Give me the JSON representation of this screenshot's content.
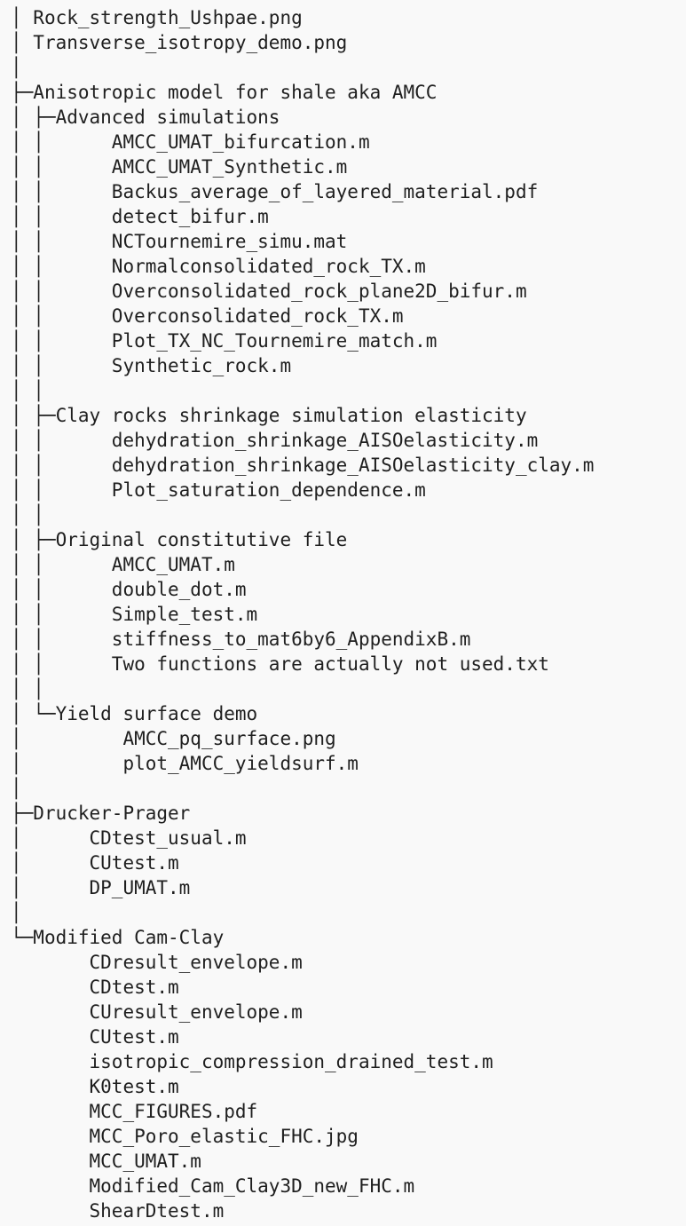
{
  "tree": {
    "lines": [
      {
        "prefix": "│ ",
        "text": "Rock_strength_Ushpae.png"
      },
      {
        "prefix": "│ ",
        "text": "Transverse_isotropy_demo.png"
      },
      {
        "prefix": "│",
        "text": ""
      },
      {
        "prefix": "├─",
        "text": "Anisotropic model for shale aka AMCC"
      },
      {
        "prefix": "│ ├─",
        "text": "Advanced simulations"
      },
      {
        "prefix": "│ │      ",
        "text": "AMCC_UMAT_bifurcation.m"
      },
      {
        "prefix": "│ │      ",
        "text": "AMCC_UMAT_Synthetic.m"
      },
      {
        "prefix": "│ │      ",
        "text": "Backus_average_of_layered_material.pdf"
      },
      {
        "prefix": "│ │      ",
        "text": "detect_bifur.m"
      },
      {
        "prefix": "│ │      ",
        "text": "NCTournemire_simu.mat"
      },
      {
        "prefix": "│ │      ",
        "text": "Normalconsolidated_rock_TX.m"
      },
      {
        "prefix": "│ │      ",
        "text": "Overconsolidated_rock_plane2D_bifur.m"
      },
      {
        "prefix": "│ │      ",
        "text": "Overconsolidated_rock_TX.m"
      },
      {
        "prefix": "│ │      ",
        "text": "Plot_TX_NC_Tournemire_match.m"
      },
      {
        "prefix": "│ │      ",
        "text": "Synthetic_rock.m"
      },
      {
        "prefix": "│ │",
        "text": ""
      },
      {
        "prefix": "│ ├─",
        "text": "Clay rocks shrinkage simulation elasticity"
      },
      {
        "prefix": "│ │      ",
        "text": "dehydration_shrinkage_AISOelasticity.m"
      },
      {
        "prefix": "│ │      ",
        "text": "dehydration_shrinkage_AISOelasticity_clay.m"
      },
      {
        "prefix": "│ │      ",
        "text": "Plot_saturation_dependence.m"
      },
      {
        "prefix": "│ │",
        "text": ""
      },
      {
        "prefix": "│ ├─",
        "text": "Original constitutive file"
      },
      {
        "prefix": "│ │      ",
        "text": "AMCC_UMAT.m"
      },
      {
        "prefix": "│ │      ",
        "text": "double_dot.m"
      },
      {
        "prefix": "│ │      ",
        "text": "Simple_test.m"
      },
      {
        "prefix": "│ │      ",
        "text": "stiffness_to_mat6by6_AppendixB.m"
      },
      {
        "prefix": "│ │      ",
        "text": "Two functions are actually not used.txt"
      },
      {
        "prefix": "│ │",
        "text": ""
      },
      {
        "prefix": "│ └─",
        "text": "Yield surface demo"
      },
      {
        "prefix": "│         ",
        "text": "AMCC_pq_surface.png"
      },
      {
        "prefix": "│         ",
        "text": "plot_AMCC_yieldsurf.m"
      },
      {
        "prefix": "│",
        "text": ""
      },
      {
        "prefix": "├─",
        "text": "Drucker-Prager"
      },
      {
        "prefix": "│      ",
        "text": "CDtest_usual.m"
      },
      {
        "prefix": "│      ",
        "text": "CUtest.m"
      },
      {
        "prefix": "│      ",
        "text": "DP_UMAT.m"
      },
      {
        "prefix": "│",
        "text": ""
      },
      {
        "prefix": "└─",
        "text": "Modified Cam-Clay"
      },
      {
        "prefix": "       ",
        "text": "CDresult_envelope.m"
      },
      {
        "prefix": "       ",
        "text": "CDtest.m"
      },
      {
        "prefix": "       ",
        "text": "CUresult_envelope.m"
      },
      {
        "prefix": "       ",
        "text": "CUtest.m"
      },
      {
        "prefix": "       ",
        "text": "isotropic_compression_drained_test.m"
      },
      {
        "prefix": "       ",
        "text": "K0test.m"
      },
      {
        "prefix": "       ",
        "text": "MCC_FIGURES.pdf"
      },
      {
        "prefix": "       ",
        "text": "MCC_Poro_elastic_FHC.jpg"
      },
      {
        "prefix": "       ",
        "text": "MCC_UMAT.m"
      },
      {
        "prefix": "       ",
        "text": "Modified_Cam_Clay3D_new_FHC.m"
      },
      {
        "prefix": "       ",
        "text": "ShearDtest.m"
      }
    ]
  }
}
